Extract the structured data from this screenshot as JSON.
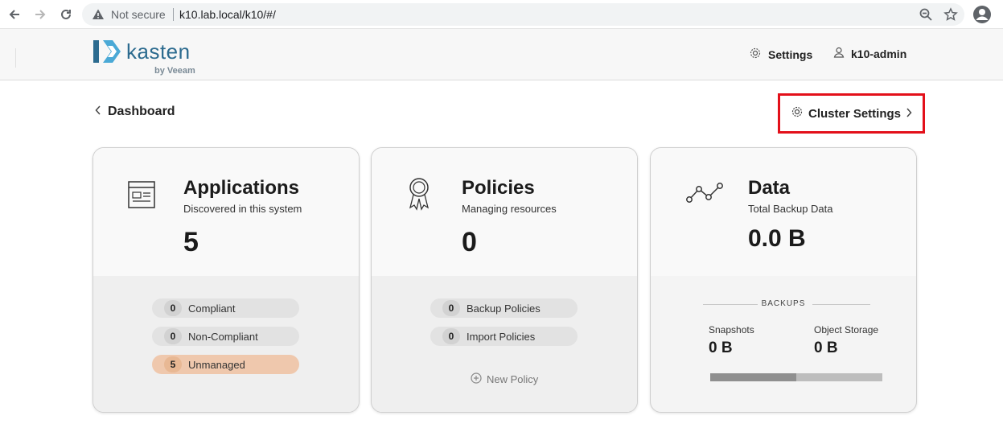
{
  "browser": {
    "security_label": "Not secure",
    "url": "k10.lab.local/k10/#/"
  },
  "header": {
    "logo_text": "kasten",
    "logo_byline": "by Veeam",
    "settings_label": "Settings",
    "user_label": "k10-admin"
  },
  "page": {
    "breadcrumb": "Dashboard",
    "cluster_settings_label": "Cluster Settings",
    "highlight_color": "#e3101a"
  },
  "cards": {
    "applications": {
      "title": "Applications",
      "subtitle": "Discovered in this system",
      "count": "5",
      "stats": [
        {
          "count": "0",
          "label": "Compliant"
        },
        {
          "count": "0",
          "label": "Non-Compliant"
        },
        {
          "count": "5",
          "label": "Unmanaged"
        }
      ]
    },
    "policies": {
      "title": "Policies",
      "subtitle": "Managing resources",
      "count": "0",
      "stats": [
        {
          "count": "0",
          "label": "Backup Policies"
        },
        {
          "count": "0",
          "label": "Import Policies"
        }
      ],
      "new_policy_label": "New Policy"
    },
    "data": {
      "title": "Data",
      "subtitle": "Total Backup Data",
      "total": "0.0 B",
      "backups_heading": "BACKUPS",
      "snapshots_label": "Snapshots",
      "snapshots_value": "0 B",
      "object_storage_label": "Object Storage",
      "object_storage_value": "0 B",
      "snapshot_fraction": 0.5
    }
  },
  "icons": {
    "back": "back-arrow-icon",
    "forward": "forward-arrow-icon",
    "reload": "reload-icon",
    "warning": "warning-icon",
    "zoom": "zoom-icon",
    "star": "star-icon",
    "profile": "profile-icon",
    "gear": "gear-icon",
    "user": "user-icon",
    "applications": "browser-window-icon",
    "policies": "ribbon-award-icon",
    "data": "line-graph-icon",
    "plus": "plus-circle-icon"
  },
  "colors": {
    "brand": "#2c6b8f",
    "logo_accent": "#4aa9d6",
    "unmanaged_pill": "#efc8ad",
    "pill": "#e2e2e2"
  }
}
